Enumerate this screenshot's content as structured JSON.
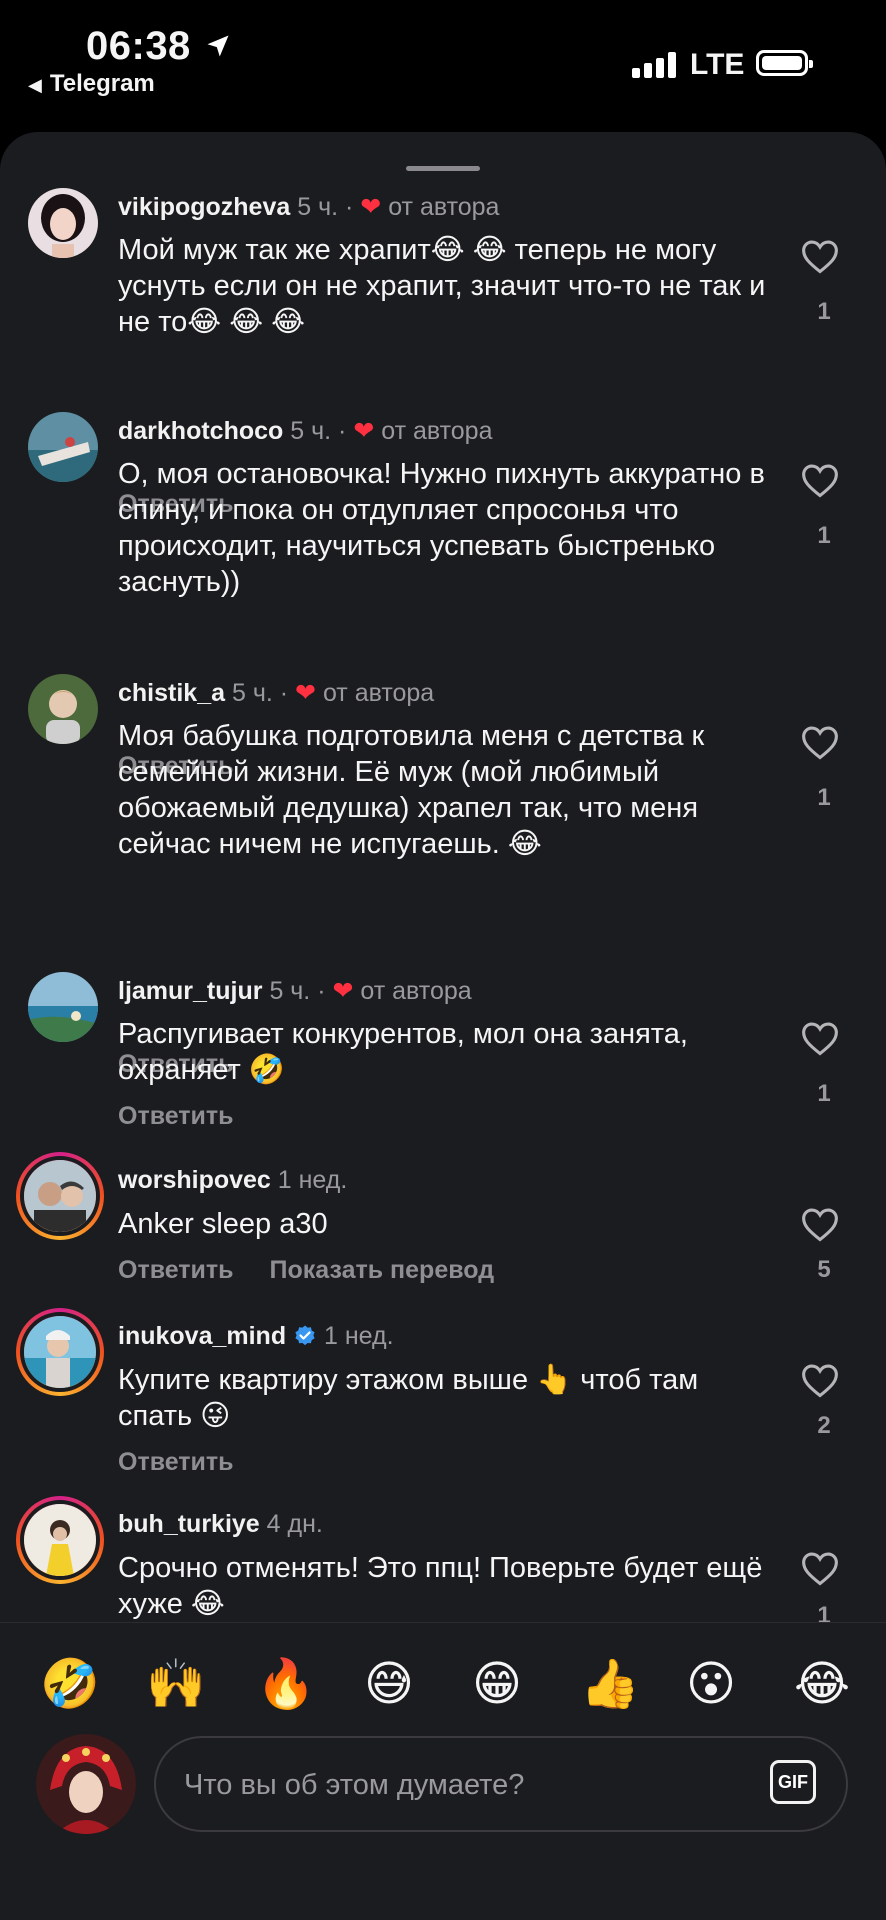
{
  "status_bar": {
    "time": "06:38",
    "back_app": "Telegram",
    "network": "LTE",
    "icons": [
      "location-arrow-icon",
      "signal-bars-icon",
      "battery-icon"
    ]
  },
  "comments": [
    {
      "username": "vikipogozheva",
      "time": "5 ч.",
      "separator": "·",
      "author_like": "от автора",
      "text": "Мой муж так же храпит😂 😂 теперь не могу уснуть если он не храпит, значит что-то  не так и не то😂 😂 😂",
      "reply": "Ответить",
      "likes": "1"
    },
    {
      "username": "darkhotchoco",
      "time": "5 ч.",
      "separator": "·",
      "author_like": "от автора",
      "text": "О, моя остановочка! Нужно пихнуть аккуратно в спину, и пока он отдупляет спросонья что происходит, научиться успевать быстренько заснуть))",
      "reply": "Ответить",
      "likes": "1"
    },
    {
      "username": "chistik_a",
      "time": "5 ч.",
      "separator": "·",
      "author_like": "от автора",
      "text": "Моя бабушка подготовила меня с детства к семейной жизни. Её муж (мой любимый обожаемый дедушка) храпел так, что меня сейчас ничем не испугаешь. 😂",
      "reply": "Ответить",
      "likes": "1"
    },
    {
      "username": "ljamur_tujur",
      "time": "5 ч.",
      "separator": "·",
      "author_like": "от автора",
      "text": "Распугивает конкурентов, мол она занята, охраняет 🤣",
      "reply": "Ответить",
      "likes": "1"
    },
    {
      "username": "worshipovec",
      "time": "1 нед.",
      "text": "Anker sleep a30",
      "reply": "Ответить",
      "translate": "Показать перевод",
      "likes": "5"
    },
    {
      "username": "inukova_mind",
      "verified": true,
      "time": "1 нед.",
      "text": "Купите квартиру этажом выше 👆 чтоб там спать 😜",
      "reply": "Ответить",
      "likes": "2"
    },
    {
      "username": "buh_turkiye",
      "time": "4 дн.",
      "text": "Срочно отменять! Это ппц! Поверьте будет ещё хуже 😂",
      "likes": "1"
    }
  ],
  "emoji_bar": [
    "🤣",
    "🙌",
    "🔥",
    "😅",
    "😁",
    "👍",
    "😮",
    "😂"
  ],
  "composer": {
    "placeholder": "Что вы об этом думаете?",
    "gif_label": "GIF"
  },
  "colors": {
    "sheet_bg": "#1b1c1f",
    "heart_red": "#ff3040",
    "muted": "#9a9a9e",
    "verified_blue": "#3897f0"
  }
}
